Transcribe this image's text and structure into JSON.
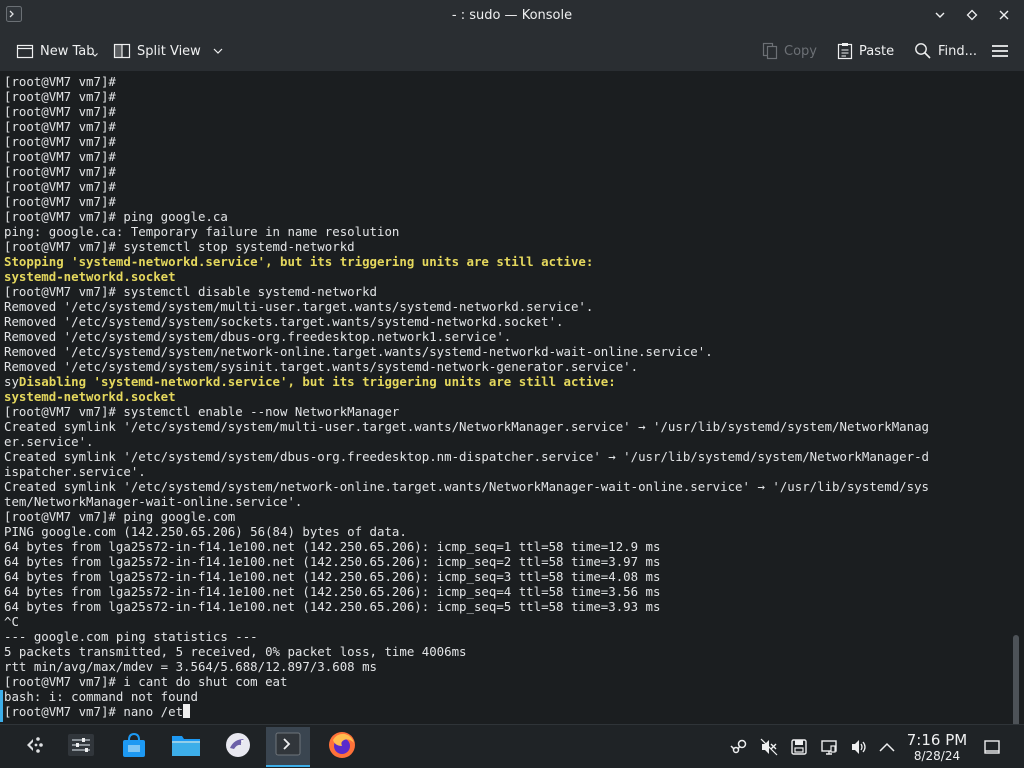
{
  "window": {
    "title": "- : sudo — Konsole"
  },
  "toolbar": {
    "new_tab": "New Tab",
    "split_view": "Split View",
    "copy": "Copy",
    "paste": "Paste",
    "find": "Find..."
  },
  "terminal": {
    "lines": [
      {
        "text": "[root@VM7 vm7]#"
      },
      {
        "text": "[root@VM7 vm7]#"
      },
      {
        "text": "[root@VM7 vm7]#"
      },
      {
        "text": "[root@VM7 vm7]#"
      },
      {
        "text": "[root@VM7 vm7]#"
      },
      {
        "text": "[root@VM7 vm7]#"
      },
      {
        "text": "[root@VM7 vm7]#"
      },
      {
        "text": "[root@VM7 vm7]#"
      },
      {
        "text": "[root@VM7 vm7]#"
      },
      {
        "text": "[root@VM7 vm7]# ping google.ca"
      },
      {
        "text": "ping: google.ca: Temporary failure in name resolution"
      },
      {
        "text": "[root@VM7 vm7]# systemctl stop systemd-networkd"
      },
      {
        "text": "Stopping 'systemd-networkd.service', but its triggering units are still active:",
        "style": "warn"
      },
      {
        "text": "systemd-networkd.socket",
        "style": "warn"
      },
      {
        "text": "[root@VM7 vm7]# systemctl disable systemd-networkd"
      },
      {
        "text": "Removed '/etc/systemd/system/multi-user.target.wants/systemd-networkd.service'."
      },
      {
        "text": "Removed '/etc/systemd/system/sockets.target.wants/systemd-networkd.socket'."
      },
      {
        "text": "Removed '/etc/systemd/system/dbus-org.freedesktop.network1.service'."
      },
      {
        "text": "Removed '/etc/systemd/system/network-online.target.wants/systemd-networkd-wait-online.service'."
      },
      {
        "text": "Removed '/etc/systemd/system/sysinit.target.wants/systemd-network-generator.service'."
      },
      {
        "prefix": "sy",
        "text": "Disabling 'systemd-networkd.service', but its triggering units are still active:",
        "style": "warn"
      },
      {
        "text": "systemd-networkd.socket",
        "style": "warn"
      },
      {
        "text": "[root@VM7 vm7]# systemctl enable --now NetworkManager"
      },
      {
        "text": "Created symlink '/etc/systemd/system/multi-user.target.wants/NetworkManager.service' → '/usr/lib/systemd/system/NetworkManag"
      },
      {
        "text": "er.service'."
      },
      {
        "text": "Created symlink '/etc/systemd/system/dbus-org.freedesktop.nm-dispatcher.service' → '/usr/lib/systemd/system/NetworkManager-d"
      },
      {
        "text": "ispatcher.service'."
      },
      {
        "text": "Created symlink '/etc/systemd/system/network-online.target.wants/NetworkManager-wait-online.service' → '/usr/lib/systemd/sys"
      },
      {
        "text": "tem/NetworkManager-wait-online.service'."
      },
      {
        "text": "[root@VM7 vm7]# ping google.com"
      },
      {
        "text": "PING google.com (142.250.65.206) 56(84) bytes of data."
      },
      {
        "text": "64 bytes from lga25s72-in-f14.1e100.net (142.250.65.206): icmp_seq=1 ttl=58 time=12.9 ms"
      },
      {
        "text": "64 bytes from lga25s72-in-f14.1e100.net (142.250.65.206): icmp_seq=2 ttl=58 time=3.97 ms"
      },
      {
        "text": "64 bytes from lga25s72-in-f14.1e100.net (142.250.65.206): icmp_seq=3 ttl=58 time=4.08 ms"
      },
      {
        "text": "64 bytes from lga25s72-in-f14.1e100.net (142.250.65.206): icmp_seq=4 ttl=58 time=3.56 ms"
      },
      {
        "text": "64 bytes from lga25s72-in-f14.1e100.net (142.250.65.206): icmp_seq=5 ttl=58 time=3.93 ms"
      },
      {
        "text": "^C"
      },
      {
        "text": "--- google.com ping statistics ---"
      },
      {
        "text": "5 packets transmitted, 5 received, 0% packet loss, time 4006ms"
      },
      {
        "text": "rtt min/avg/max/mdev = 3.564/5.688/12.897/3.608 ms"
      },
      {
        "text": "[root@VM7 vm7]# i cant do shut com eat"
      },
      {
        "text": "bash: i: command not found"
      },
      {
        "text": "[root@VM7 vm7]# nano /et",
        "cursor": true
      }
    ]
  },
  "taskbar": {
    "apps": [
      {
        "name": "application-launcher",
        "icon": "kde-launcher-icon",
        "active": false
      },
      {
        "name": "system-settings",
        "icon": "settings-sliders-icon",
        "active": false
      },
      {
        "name": "discover",
        "icon": "store-bag-icon",
        "active": false
      },
      {
        "name": "dolphin",
        "icon": "folder-icon",
        "active": false
      },
      {
        "name": "kde-connect",
        "icon": "bird-icon",
        "active": false
      },
      {
        "name": "konsole",
        "icon": "terminal-icon",
        "active": true
      },
      {
        "name": "firefox",
        "icon": "firefox-icon",
        "active": false
      }
    ],
    "tray": [
      "steam-icon",
      "audio-muted-icon",
      "storage-icon",
      "clipboard-icon",
      "volume-icon",
      "expand-tray-icon"
    ],
    "clock": {
      "time": "7:16 PM",
      "date": "8/28/24"
    }
  },
  "colors": {
    "accent": "#3daee9",
    "terminal_bg": "#1b1e20",
    "warning_text": "#e5d85d"
  }
}
